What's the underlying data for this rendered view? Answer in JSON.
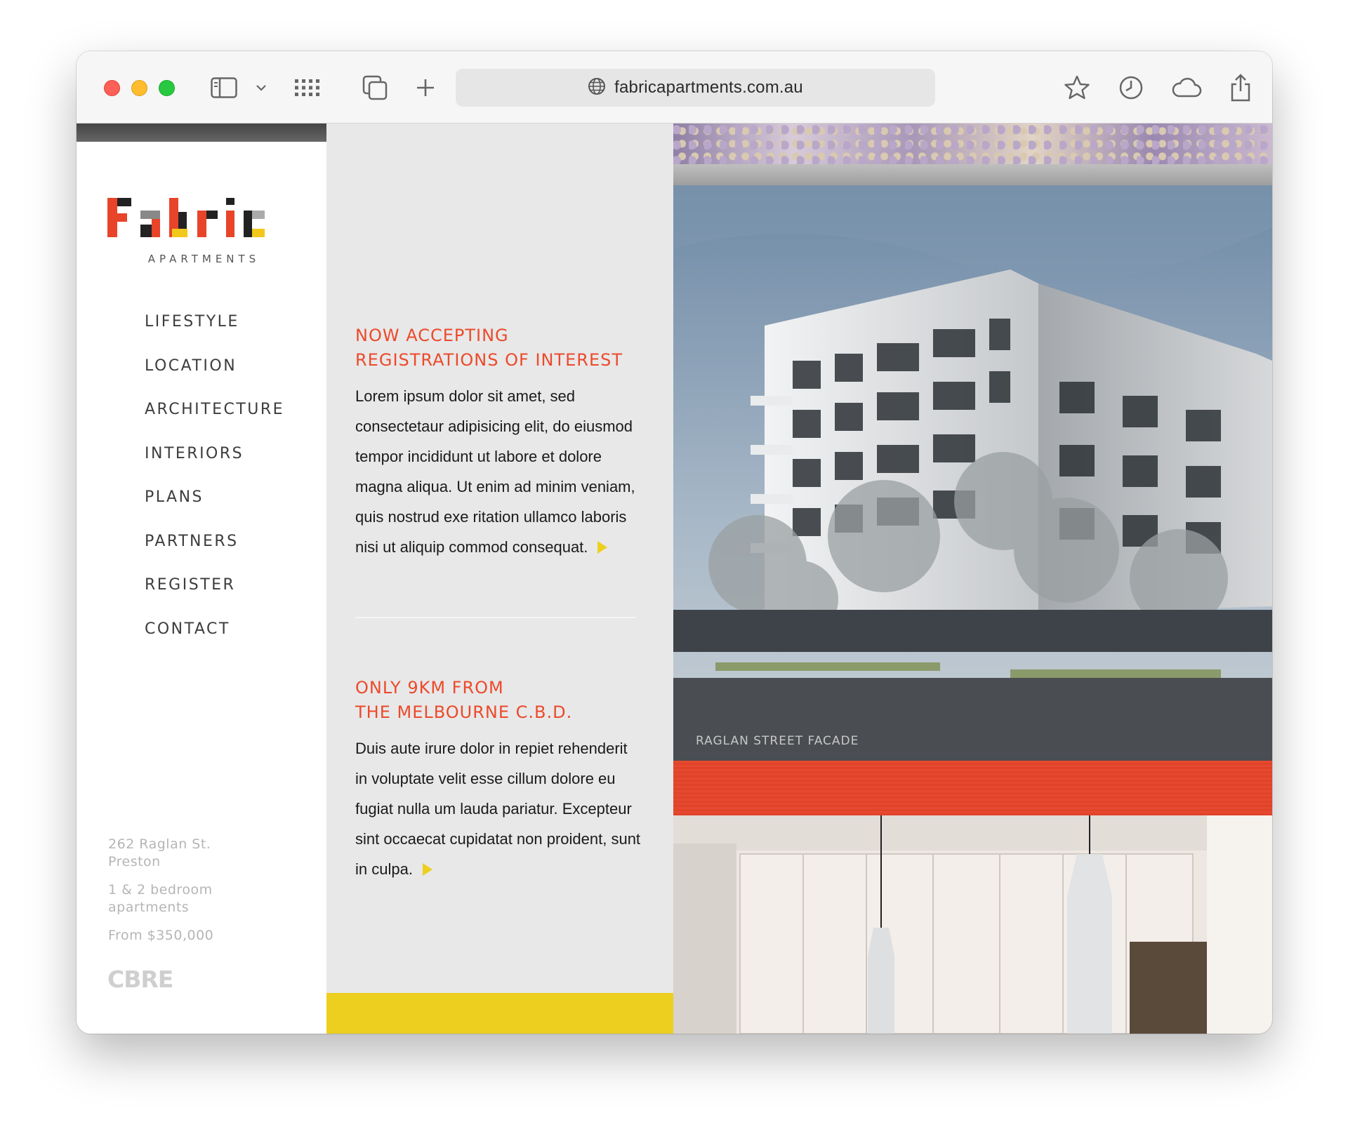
{
  "browser": {
    "url": "fabricapartments.com.au",
    "icons": [
      "sidebar-icon",
      "chevron-down-icon",
      "grid-icon",
      "tabs-icon",
      "plus-icon",
      "globe-icon",
      "star-icon",
      "history-icon",
      "cloud-icon",
      "share-icon"
    ]
  },
  "logo": {
    "wordmark": "Fabric",
    "subtitle": "APARTMENTS"
  },
  "nav": [
    {
      "label": "LIFESTYLE"
    },
    {
      "label": "LOCATION"
    },
    {
      "label": "ARCHITECTURE"
    },
    {
      "label": "INTERIORS"
    },
    {
      "label": "PLANS"
    },
    {
      "label": "PARTNERS"
    },
    {
      "label": "REGISTER"
    },
    {
      "label": "CONTACT"
    }
  ],
  "address": {
    "street": "262 Raglan St.",
    "suburb": "Preston",
    "beds_line1": "1 & 2 bedroom",
    "beds_line2": "apartments",
    "price": "From $350,000"
  },
  "partner_logo": "CBRE",
  "articles": [
    {
      "heading_line1": "NOW ACCEPTING",
      "heading_line2": "REGISTRATIONS OF INTEREST",
      "body": "Lorem ipsum dolor sit amet, sed consectetaur adipisicing elit, do eiusmod tempor incididunt ut labore et dolore magna aliqua. Ut enim ad minim veniam, quis nostrud exe ritation ullamco laboris nisi ut aliquip commod consequat."
    },
    {
      "heading_line1": "ONLY 9KM FROM",
      "heading_line2": "THE MELBOURNE C.B.D.",
      "body": "Duis aute irure dolor in repiet rehenderit in voluptate velit esse cillum dolore eu fugiat nulla um lauda pariatur. Excepteur sint occaecat cupidatat non proident, sunt in culpa."
    }
  ],
  "gallery": {
    "caption": "RAGLAN STREET FACADE"
  },
  "colors": {
    "accent_red": "#ec4a2a",
    "accent_yellow": "#eccf1f",
    "middle_bg": "#e8e8e9"
  }
}
